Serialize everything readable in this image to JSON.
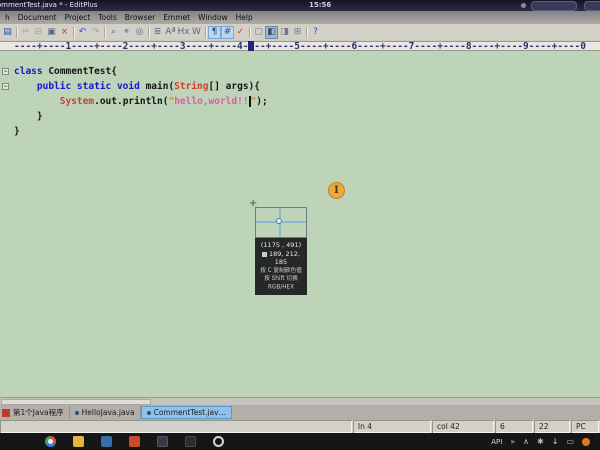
{
  "window": {
    "title": "CommentTest.java * - EditPlus"
  },
  "overlay": {
    "clock": "15:56",
    "cursor_glyph": "I"
  },
  "menu": {
    "items": [
      {
        "label": "h"
      },
      {
        "label": "Document"
      },
      {
        "label": "Project"
      },
      {
        "label": "Tools"
      },
      {
        "label": "Browser"
      },
      {
        "label": "Emmet"
      },
      {
        "label": "Window"
      },
      {
        "label": "Help"
      }
    ]
  },
  "toolbar": {
    "icons": [
      {
        "glyph": "▤",
        "cls": "b"
      },
      {
        "glyph": "✂",
        "cls": "g"
      },
      {
        "glyph": "⊟",
        "cls": "g"
      },
      {
        "glyph": "▣",
        "cls": "n"
      },
      {
        "glyph": "×",
        "cls": "r"
      },
      {
        "glyph": "↶",
        "cls": "b"
      },
      {
        "glyph": "↷",
        "cls": "g"
      },
      {
        "glyph": "⌕",
        "cls": "n"
      },
      {
        "glyph": "⌖",
        "cls": "n"
      },
      {
        "glyph": "◎",
        "cls": "n"
      },
      {
        "glyph": "≣",
        "cls": "n"
      },
      {
        "glyph": "Aª",
        "cls": "n"
      },
      {
        "glyph": "Hx",
        "cls": "n"
      },
      {
        "glyph": "W",
        "cls": "n"
      },
      {
        "glyph": "¶",
        "cls": "a"
      },
      {
        "glyph": "#",
        "cls": "a"
      },
      {
        "glyph": "✓",
        "cls": "r"
      },
      {
        "glyph": "▢",
        "cls": "w"
      },
      {
        "glyph": "◧",
        "cls": "wp"
      },
      {
        "glyph": "◨",
        "cls": "w"
      },
      {
        "glyph": "⊞",
        "cls": "w"
      },
      {
        "glyph": "?",
        "cls": "b"
      }
    ]
  },
  "ruler": {
    "text": "----+----1----+----2----+----3----+----4----+----5----+----6----+----7----+----8----+----9----+----0"
  },
  "code": {
    "l1": {
      "kw": "class ",
      "pl": "CommentTest{"
    },
    "l2": {
      "ind": "    ",
      "kw": "public static void ",
      "pl": "main(",
      "ty": "String",
      "pl2": "[] args){"
    },
    "l3": {
      "ind": "        ",
      "ty": "System",
      "pl": ".out.println(",
      "q1": "\"",
      "st": "hello,world!!",
      "q2": "\"",
      "pl2": ");"
    },
    "l4": {
      "pl": "    }"
    },
    "l5": {
      "pl": "}"
    }
  },
  "picker": {
    "coords": "(1175 , 491)",
    "rgb": "189, 212, 185",
    "swatch_color": "#bdd4b9",
    "hint1": "按 C 复制颜色值",
    "hint2": "按 Shift 切换 RGB/HEX"
  },
  "tabs": {
    "items": [
      {
        "label": "第1个Java程序",
        "cls": ""
      },
      {
        "label": "HelloJava.java",
        "cls": ""
      },
      {
        "label": "CommentTest.jav…",
        "cls": "act"
      }
    ]
  },
  "status": {
    "line": "ln 4",
    "col": "col 42",
    "v1": "6",
    "v2": "22",
    "mode": "PC"
  },
  "taskbar": {
    "tray_text": "API",
    "tray_more": "»",
    "tray_chevron": "∧"
  },
  "colors": {
    "editor_bg": "#bdd4b9",
    "keyword": "#1616c8",
    "type": "#c8432e",
    "string": "#dc5ca5",
    "quote": "#db7a1c",
    "active_tab": "#8fc2ea"
  }
}
